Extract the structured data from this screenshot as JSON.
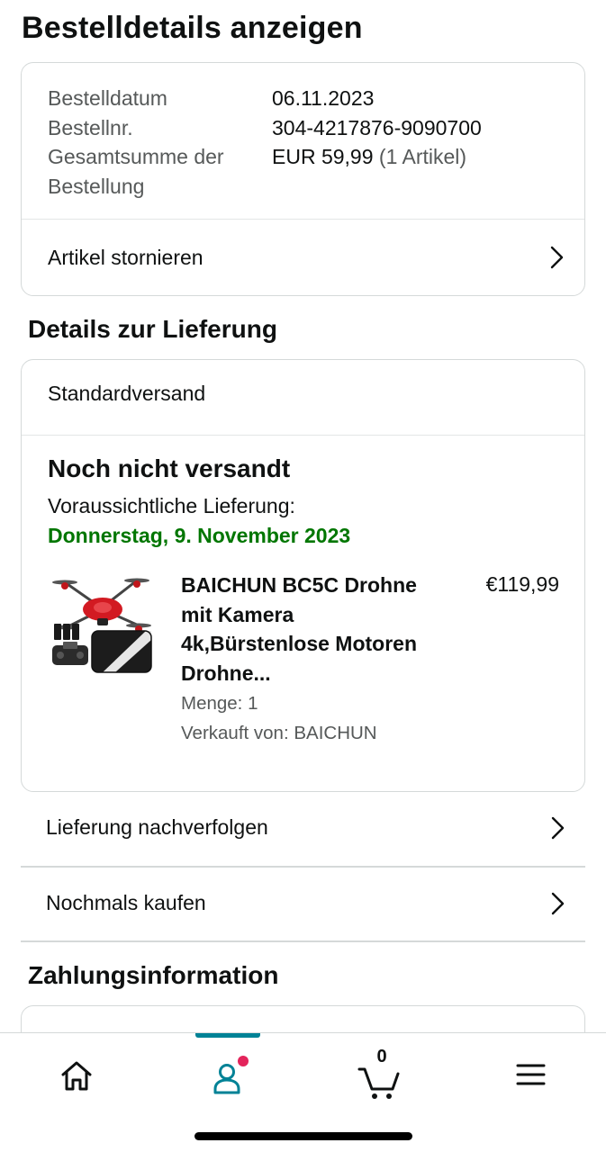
{
  "page_title": "Bestelldetails anzeigen",
  "order_summary": {
    "rows": [
      {
        "label": "Bestelldatum",
        "value": "06.11.2023"
      },
      {
        "label": "Bestellnr.",
        "value": "304-4217876-9090700"
      }
    ],
    "total_label_line1": "Gesamtsumme der",
    "total_label_line2": "Bestellung",
    "total_value": "EUR 59,99",
    "total_items": "(1 Artikel)",
    "cancel_link": "Artikel stornieren"
  },
  "delivery": {
    "section_title": "Details zur Lieferung",
    "shipping_method": "Standardversand",
    "status": "Noch nicht versandt",
    "eta_label": "Voraussichtliche Lieferung:",
    "eta_date": "Donnerstag, 9. November 2023",
    "product": {
      "title": "BAICHUN BC5C Drohne mit Kamera 4k,Bürstenlose Motoren Drohne...",
      "price": "€119,99",
      "quantity": "Menge: 1",
      "seller": "Verkauft von: BAICHUN"
    }
  },
  "actions": {
    "track": "Lieferung nachverfolgen",
    "buy_again": "Nochmals kaufen"
  },
  "payment": {
    "section_title": "Zahlungsinformation"
  },
  "bottom_nav": {
    "cart_count": "0",
    "active_tab": "account",
    "accent_color": "#008296",
    "notification_dot_color": "#e3245b"
  },
  "colors": {
    "eta_green": "#007600",
    "text": "#0f1111",
    "secondary_text": "#565959",
    "border": "#d5d9d9"
  }
}
